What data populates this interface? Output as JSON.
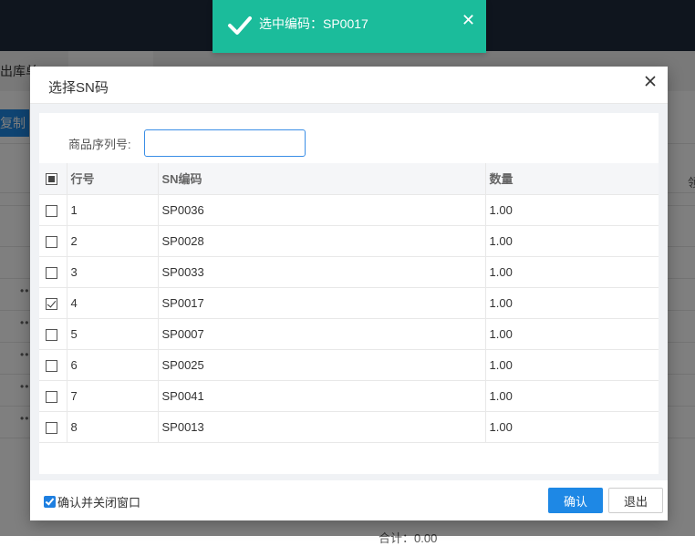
{
  "background": {
    "tab_label": "出库单",
    "copy_button": "复制",
    "right_text": "领",
    "bottom_text": "合计：0.00"
  },
  "toast": {
    "message": "选中编码：SP0017",
    "icon": "check-icon",
    "close_icon": "close-icon",
    "color": "#1bbc9b"
  },
  "dialog": {
    "title": "选择SN码",
    "search_label": "商品序列号:",
    "search_value": "",
    "columns": [
      "行号",
      "SN编码",
      "数量"
    ],
    "rows": [
      {
        "line": "1",
        "sn": "SP0036",
        "qty": "1.00",
        "checked": false
      },
      {
        "line": "2",
        "sn": "SP0028",
        "qty": "1.00",
        "checked": false
      },
      {
        "line": "3",
        "sn": "SP0033",
        "qty": "1.00",
        "checked": false
      },
      {
        "line": "4",
        "sn": "SP0017",
        "qty": "1.00",
        "checked": true
      },
      {
        "line": "5",
        "sn": "SP0007",
        "qty": "1.00",
        "checked": false
      },
      {
        "line": "6",
        "sn": "SP0025",
        "qty": "1.00",
        "checked": false
      },
      {
        "line": "7",
        "sn": "SP0041",
        "qty": "1.00",
        "checked": false
      },
      {
        "line": "8",
        "sn": "SP0013",
        "qty": "1.00",
        "checked": false
      }
    ],
    "confirm_close_label": "确认并关闭窗口",
    "confirm_close_checked": true,
    "ok_label": "确认",
    "exit_label": "退出",
    "accent": "#1e88e5"
  }
}
